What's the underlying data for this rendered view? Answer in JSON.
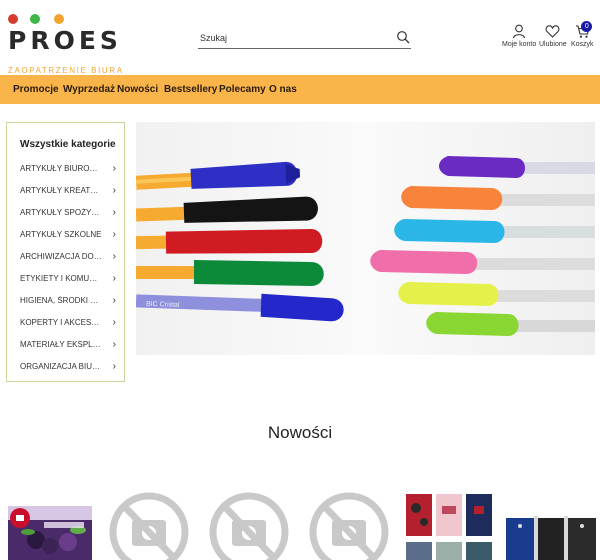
{
  "brand": {
    "name": "PROES",
    "tagline": "ZAOPATRZENIE BIURA",
    "dot_colors": [
      "#d63b2f",
      "#3fb54a",
      "#f2a52d"
    ]
  },
  "search": {
    "placeholder": "Szukaj",
    "icon": "search-icon"
  },
  "header_actions": [
    {
      "label": "Moje konto",
      "icon": "user-icon"
    },
    {
      "label": "Ulubione",
      "icon": "heart-icon"
    },
    {
      "label": "Koszyk",
      "icon": "cart-icon",
      "badge": "0"
    }
  ],
  "nav": [
    "Promocje",
    "Wyprzedaż",
    "Nowości",
    "Bestsellery",
    "Polecamy",
    "O nas"
  ],
  "categories": {
    "title": "Wszystkie kategorie",
    "items": [
      "ARTYKUŁY BIUROWE",
      "ARTYKUŁY KREATYWNE",
      "ARTYKUŁY SPOŻYWCZE",
      "ARTYKUŁY SZKOLNE",
      "ARCHIWIZACJA DOKUMENTÓW",
      "ETYKIETY I KOMUNIKACJA",
      "HIGIENA, ŚRODKI CZYSTOŚCI",
      "KOPERTY I AKCESORIA",
      "MATERIAŁY EKSPLOATACYJNE",
      "ORGANIZACJA BIURA"
    ]
  },
  "banner": {
    "pen_brand": "BIC Cristal"
  },
  "section": {
    "title": "Nowości"
  },
  "colors": {
    "accent": "#f9b44a",
    "badge": "#1a1aa6",
    "panel_border": "#c8d69a"
  }
}
